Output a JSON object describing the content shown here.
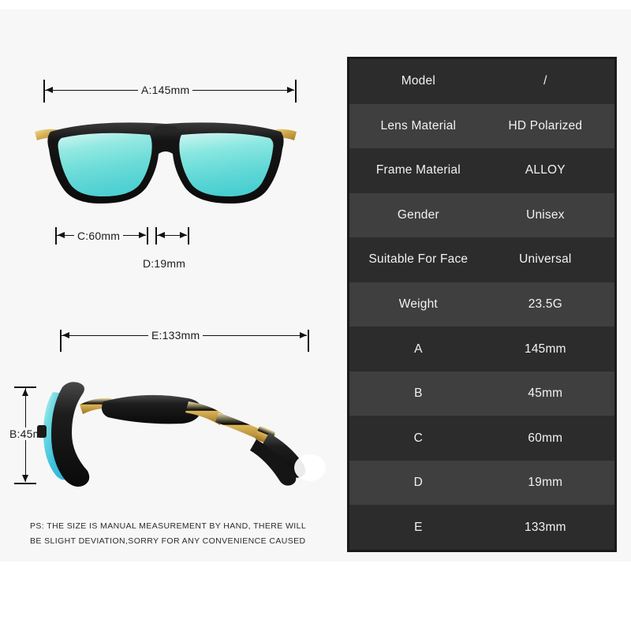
{
  "background_color": "#f7f7f7",
  "diagram": {
    "front_view": {
      "name": "sunglasses-front-view",
      "description": "black wayfarer sunglasses with cyan mirrored lenses and gold hinge accents, front view",
      "frame_color": "#191919",
      "lens_color": "#7fe0da",
      "accent_color": "#d9b352"
    },
    "side_view": {
      "name": "sunglasses-side-view",
      "description": "black wayfarer sunglasses with cyan mirrored lens and gold metal temple arm, side profile view",
      "frame_color": "#191919",
      "lens_color": "#55cfe0",
      "accent_color": "#d9b352"
    },
    "measurements": [
      {
        "key": "A",
        "label": "A:145mm",
        "description": "total frame width"
      },
      {
        "key": "B",
        "label": "B:45mm",
        "description": "lens height"
      },
      {
        "key": "C",
        "label": "C:60mm",
        "description": "lens width"
      },
      {
        "key": "D",
        "label": "D:19mm",
        "description": "bridge width"
      },
      {
        "key": "E",
        "label": "E:133mm",
        "description": "temple arm length"
      }
    ]
  },
  "note": {
    "line1": "PS: THE SIZE IS MANUAL MEASUREMENT BY HAND, THERE WILL",
    "line2": "BE SLIGHT DEVIATION,SORRY FOR ANY CONVENIENCE CAUSED"
  },
  "spec_table": {
    "rows": [
      {
        "key": "Model",
        "value": "/"
      },
      {
        "key": "Lens Material",
        "value": "HD Polarized"
      },
      {
        "key": "Frame Material",
        "value": "ALLOY"
      },
      {
        "key": "Gender",
        "value": "Unisex"
      },
      {
        "key": "Suitable For Face",
        "value": "Universal"
      },
      {
        "key": "Weight",
        "value": "23.5G"
      },
      {
        "key": "A",
        "value": "145mm"
      },
      {
        "key": "B",
        "value": "45mm"
      },
      {
        "key": "C",
        "value": "60mm"
      },
      {
        "key": "D",
        "value": "19mm"
      },
      {
        "key": "E",
        "value": "133mm"
      }
    ],
    "row_color_odd": "#2c2c2c",
    "row_color_even": "#3f3f3f",
    "text_color": "#f2f2f2",
    "border_color": "#1a1a1a"
  }
}
